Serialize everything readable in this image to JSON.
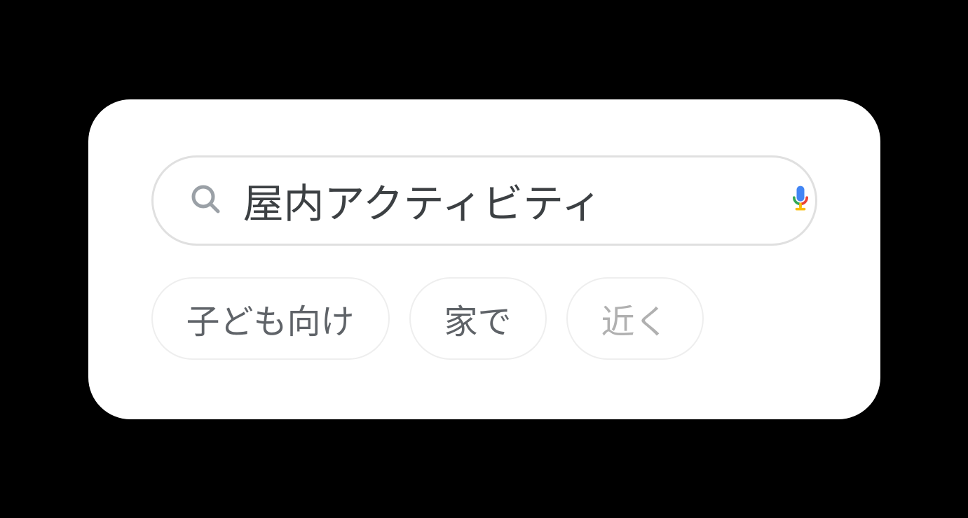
{
  "search": {
    "query": "屋内アクティビティ"
  },
  "chips": [
    {
      "label": "子ども向け",
      "faded": false
    },
    {
      "label": "家で",
      "faded": false
    },
    {
      "label": "近く",
      "faded": true
    }
  ]
}
